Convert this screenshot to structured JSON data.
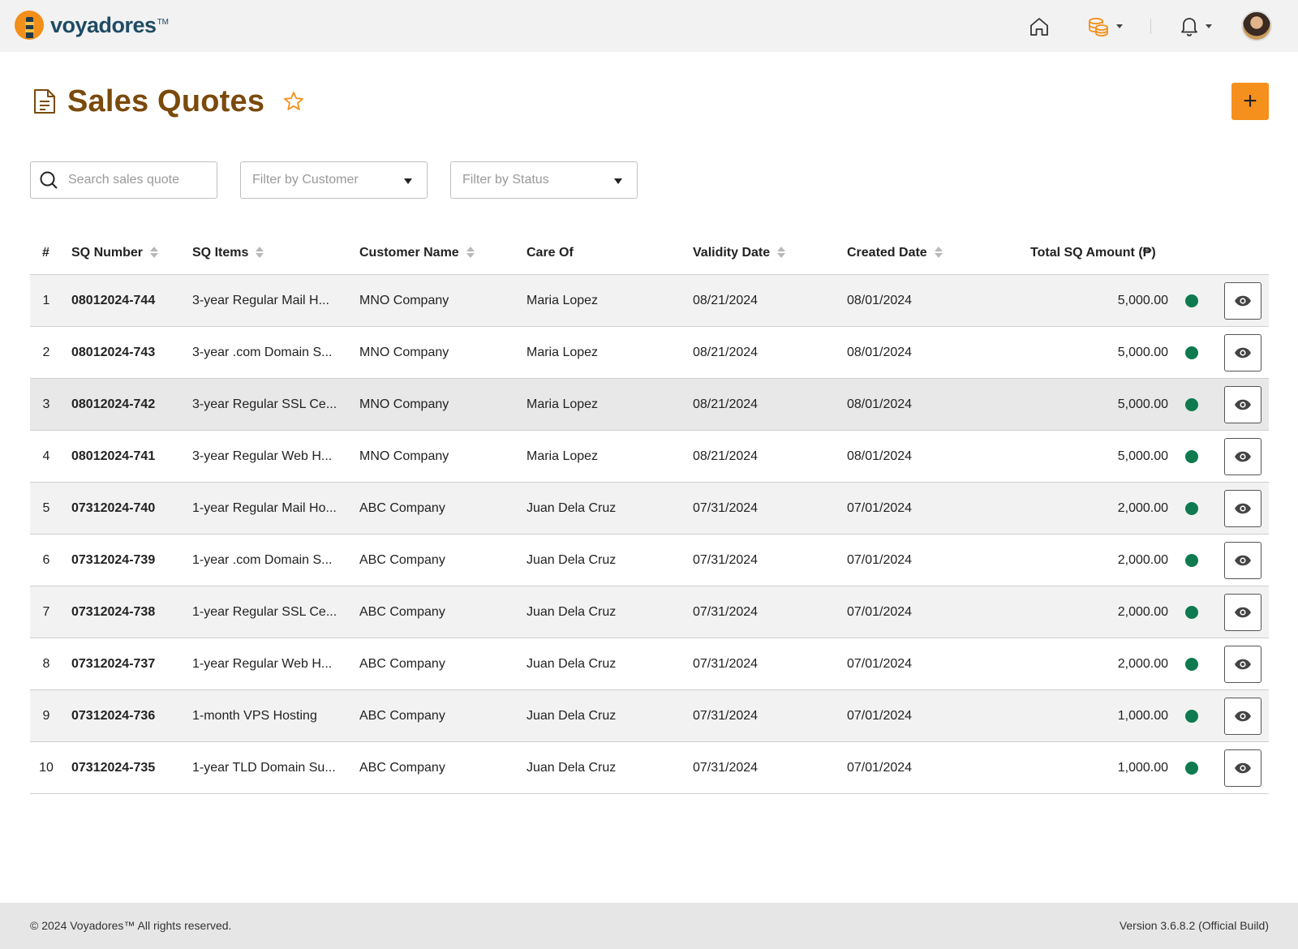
{
  "app": {
    "brand_name": "voyadores",
    "brand_tm": "TM",
    "accent_color": "#f5901c",
    "title_color": "#7a4a0c",
    "status_green": "#0e7a4e"
  },
  "nav": {
    "home_icon": "home-icon",
    "coins_icon": "coins-icon",
    "bell_icon": "bell-icon"
  },
  "page": {
    "title": "Sales Quotes",
    "add_label": "+"
  },
  "filters": {
    "search_placeholder": "Search sales quote",
    "customer_placeholder": "Filter by Customer",
    "status_placeholder": "Filter by Status"
  },
  "table": {
    "headers": {
      "index": "#",
      "sq_number": "SQ Number",
      "sq_items": "SQ Items",
      "customer_name": "Customer Name",
      "care_of": "Care Of",
      "validity_date": "Validity Date",
      "created_date": "Created Date",
      "total_amount": "Total SQ Amount (₱)"
    },
    "rows": [
      {
        "index": "1",
        "sq_number": "08012024-744",
        "sq_items": "3-year Regular Mail H...",
        "customer_name": "MNO Company",
        "care_of": "Maria Lopez",
        "validity_date": "08/21/2024",
        "created_date": "08/01/2024",
        "total_amount": "5,000.00"
      },
      {
        "index": "2",
        "sq_number": "08012024-743",
        "sq_items": "3-year .com Domain S...",
        "customer_name": "MNO Company",
        "care_of": "Maria Lopez",
        "validity_date": "08/21/2024",
        "created_date": "08/01/2024",
        "total_amount": "5,000.00"
      },
      {
        "index": "3",
        "sq_number": "08012024-742",
        "sq_items": "3-year Regular SSL Ce...",
        "customer_name": "MNO Company",
        "care_of": "Maria Lopez",
        "validity_date": "08/21/2024",
        "created_date": "08/01/2024",
        "total_amount": "5,000.00"
      },
      {
        "index": "4",
        "sq_number": "08012024-741",
        "sq_items": "3-year Regular Web H...",
        "customer_name": "MNO Company",
        "care_of": "Maria Lopez",
        "validity_date": "08/21/2024",
        "created_date": "08/01/2024",
        "total_amount": "5,000.00"
      },
      {
        "index": "5",
        "sq_number": "07312024-740",
        "sq_items": "1-year Regular Mail Ho...",
        "customer_name": "ABC Company",
        "care_of": "Juan Dela Cruz",
        "validity_date": "07/31/2024",
        "created_date": "07/01/2024",
        "total_amount": "2,000.00"
      },
      {
        "index": "6",
        "sq_number": "07312024-739",
        "sq_items": "1-year .com Domain S...",
        "customer_name": "ABC Company",
        "care_of": "Juan Dela Cruz",
        "validity_date": "07/31/2024",
        "created_date": "07/01/2024",
        "total_amount": "2,000.00"
      },
      {
        "index": "7",
        "sq_number": "07312024-738",
        "sq_items": "1-year Regular SSL Ce...",
        "customer_name": "ABC Company",
        "care_of": "Juan Dela Cruz",
        "validity_date": "07/31/2024",
        "created_date": "07/01/2024",
        "total_amount": "2,000.00"
      },
      {
        "index": "8",
        "sq_number": "07312024-737",
        "sq_items": "1-year Regular Web H...",
        "customer_name": "ABC Company",
        "care_of": "Juan Dela Cruz",
        "validity_date": "07/31/2024",
        "created_date": "07/01/2024",
        "total_amount": "2,000.00"
      },
      {
        "index": "9",
        "sq_number": "07312024-736",
        "sq_items": "1-month VPS Hosting",
        "customer_name": "ABC Company",
        "care_of": "Juan Dela Cruz",
        "validity_date": "07/31/2024",
        "created_date": "07/01/2024",
        "total_amount": "1,000.00"
      },
      {
        "index": "10",
        "sq_number": "07312024-735",
        "sq_items": "1-year TLD Domain Su...",
        "customer_name": "ABC Company",
        "care_of": "Juan Dela Cruz",
        "validity_date": "07/31/2024",
        "created_date": "07/01/2024",
        "total_amount": "1,000.00"
      }
    ]
  },
  "footer": {
    "copyright": "© 2024 Voyadores™ All rights reserved.",
    "version": "Version 3.6.8.2 (Official Build)"
  }
}
